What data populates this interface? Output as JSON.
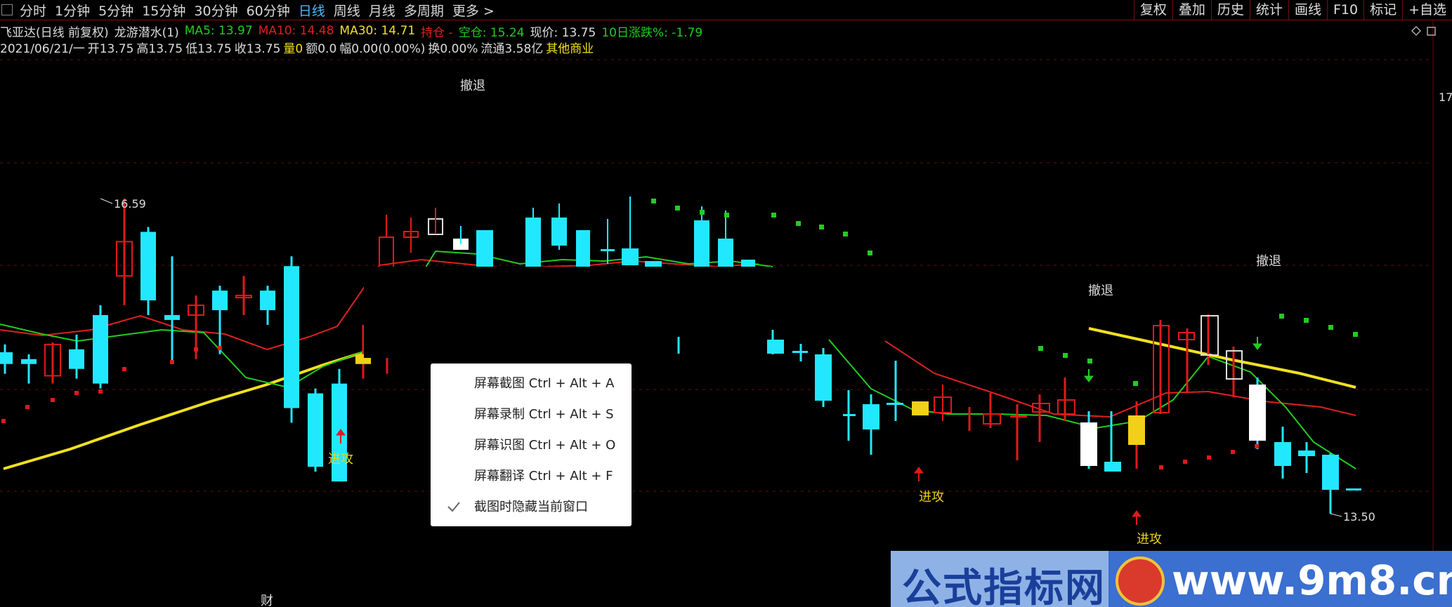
{
  "toolbar": {
    "tabs": [
      "分时",
      "1分钟",
      "5分钟",
      "15分钟",
      "30分钟",
      "60分钟",
      "日线",
      "周线",
      "月线",
      "多周期",
      "更多 >"
    ],
    "active_tab": "日线",
    "right_buttons": [
      "复权",
      "叠加",
      "历史",
      "统计",
      "画线",
      "F10",
      "标记",
      "+自选"
    ]
  },
  "info1": {
    "stock": "飞亚达(日线 前复权)",
    "indicator": "龙游潜水(1)",
    "ma5": "MA5: 13.97",
    "ma10": "MA10: 14.48",
    "ma30": "MA30: 14.71",
    "hold": "持仓 -",
    "empty": "空仓: 15.24",
    "price": "现价: 13.75",
    "change10": "10日涨跌%: -1.79"
  },
  "info2": {
    "date": "2021/06/21/一",
    "open": "开13.75",
    "high": "高13.75",
    "low": "低13.75",
    "close": "收13.75",
    "vol": "量0",
    "amt": "额0.0",
    "range": "幅0.00(0.00%)",
    "turnover": "换0.00%",
    "float": "流通3.58亿",
    "sector": "其他商业"
  },
  "labels": {
    "high_price": "16.59",
    "low_price": "13.50",
    "attack": "进攻",
    "retreat": "撤退",
    "finance_marker": "财",
    "side_number": "17"
  },
  "popup": {
    "items": [
      "屏幕截图 Ctrl + Alt + A",
      "屏幕录制 Ctrl + Alt + S",
      "屏幕识图 Ctrl + Alt + O",
      "屏幕翻译 Ctrl + Alt + F",
      "截图时隐藏当前窗口"
    ]
  },
  "watermark": {
    "cn": "公式指标网",
    "url": "www.9m8.cn"
  },
  "colors": {
    "up": "#e01a1a",
    "down": "#22e8ff",
    "ma5": "#22cc22",
    "ma10": "#e02020",
    "ma30": "#f0e020",
    "gridline": "#6a0b0b"
  },
  "chart_data": {
    "type": "candlestick",
    "price_labels": [
      "16.59",
      "13.50"
    ],
    "candles": [
      {
        "o": 15.02,
        "c": 14.9,
        "h": 15.1,
        "l": 14.8
      },
      {
        "o": 14.95,
        "c": 14.9,
        "h": 15.0,
        "l": 14.7
      },
      {
        "o": 14.78,
        "c": 15.1,
        "h": 15.12,
        "l": 14.7
      },
      {
        "o": 15.05,
        "c": 14.85,
        "h": 15.2,
        "l": 14.75
      },
      {
        "o": 15.4,
        "c": 14.7,
        "h": 15.5,
        "l": 14.65
      },
      {
        "o": 15.8,
        "c": 16.15,
        "h": 16.59,
        "l": 15.5
      },
      {
        "o": 16.25,
        "c": 15.55,
        "h": 16.3,
        "l": 15.4
      },
      {
        "o": 15.4,
        "c": 15.35,
        "h": 16.0,
        "l": 14.9
      },
      {
        "o": 15.4,
        "c": 15.5,
        "h": 15.6,
        "l": 14.95
      },
      {
        "o": 15.65,
        "c": 15.45,
        "h": 15.7,
        "l": 15.0
      },
      {
        "o": 15.6,
        "c": 15.6,
        "h": 15.8,
        "l": 15.4
      },
      {
        "o": 15.65,
        "c": 15.45,
        "h": 15.7,
        "l": 15.3
      },
      {
        "o": 15.9,
        "c": 14.45,
        "h": 16.0,
        "l": 14.3
      },
      {
        "o": 14.6,
        "c": 13.85,
        "h": 14.65,
        "l": 13.8
      },
      {
        "o": 14.7,
        "c": 13.7,
        "h": 14.85,
        "l": 13.7
      },
      {
        "o": 14.9,
        "c": 15.0,
        "h": 15.3,
        "l": 14.75
      },
      {
        "o": 15.1,
        "c": 15.5,
        "h": 15.6,
        "l": 14.8
      }
    ]
  }
}
